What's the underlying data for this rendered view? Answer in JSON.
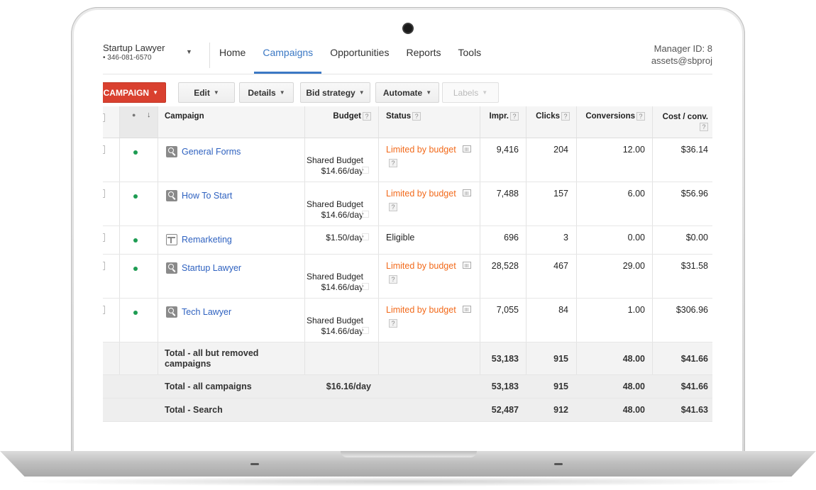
{
  "header": {
    "account_name": "Startup Lawyer",
    "account_id": "• 346-081-6570",
    "manager_id": "Manager ID: 8",
    "manager_email": "assets@sbproj"
  },
  "nav": [
    "Home",
    "Campaigns",
    "Opportunities",
    "Reports",
    "Tools"
  ],
  "nav_active": "Campaigns",
  "toolbar": {
    "campaign": "CAMPAIGN",
    "edit": "Edit",
    "details": "Details",
    "bid_strategy": "Bid strategy",
    "automate": "Automate",
    "labels": "Labels"
  },
  "columns": {
    "campaign": "Campaign",
    "budget": "Budget",
    "status": "Status",
    "impr": "Impr.",
    "clicks": "Clicks",
    "conversions": "Conversions",
    "cost_conv": "Cost / conv.",
    "help": "?"
  },
  "rows": [
    {
      "name": "General Forms",
      "budget_l1": "Shared Budget",
      "budget_l2": "$14.66/day",
      "status": "Limited by budget",
      "impr": "9,416",
      "clicks": "204",
      "conversions": "12.00",
      "cost": "$36.14"
    },
    {
      "name": "How To Start",
      "budget_l1": "Shared Budget",
      "budget_l2": "$14.66/day",
      "status": "Limited by budget",
      "impr": "7,488",
      "clicks": "157",
      "conversions": "6.00",
      "cost": "$56.96"
    },
    {
      "name": "Remarketing",
      "budget_l1": "$1.50/day",
      "status": "Eligible",
      "impr": "696",
      "clicks": "3",
      "conversions": "0.00",
      "cost": "$0.00"
    },
    {
      "name": "Startup Lawyer",
      "budget_l1": "Shared Budget",
      "budget_l2": "$14.66/day",
      "status": "Limited by budget",
      "impr": "28,528",
      "clicks": "467",
      "conversions": "29.00",
      "cost": "$31.58"
    },
    {
      "name": "Tech Lawyer",
      "budget_l1": "Shared Budget",
      "budget_l2": "$14.66/day",
      "status": "Limited by budget",
      "impr": "7,055",
      "clicks": "84",
      "conversions": "1.00",
      "cost": "$306.96"
    }
  ],
  "totals": [
    {
      "label_l1": "Total - all but removed",
      "label_l2": "campaigns",
      "budget": "",
      "impr": "53,183",
      "clicks": "915",
      "conversions": "48.00",
      "cost": "$41.66"
    },
    {
      "label_l1": "Total - all campaigns",
      "budget": "$16.16/day",
      "impr": "53,183",
      "clicks": "915",
      "conversions": "48.00",
      "cost": "$41.66"
    },
    {
      "label_l1": "Total - Search",
      "budget": "",
      "impr": "52,487",
      "clicks": "912",
      "conversions": "48.00",
      "cost": "$41.63"
    }
  ],
  "colors": {
    "accent": "#3b78c4",
    "primary_button": "#d9402f",
    "limited": "#f26a1b",
    "enabled_dot": "#1e9c53",
    "link": "#2f62c0"
  }
}
